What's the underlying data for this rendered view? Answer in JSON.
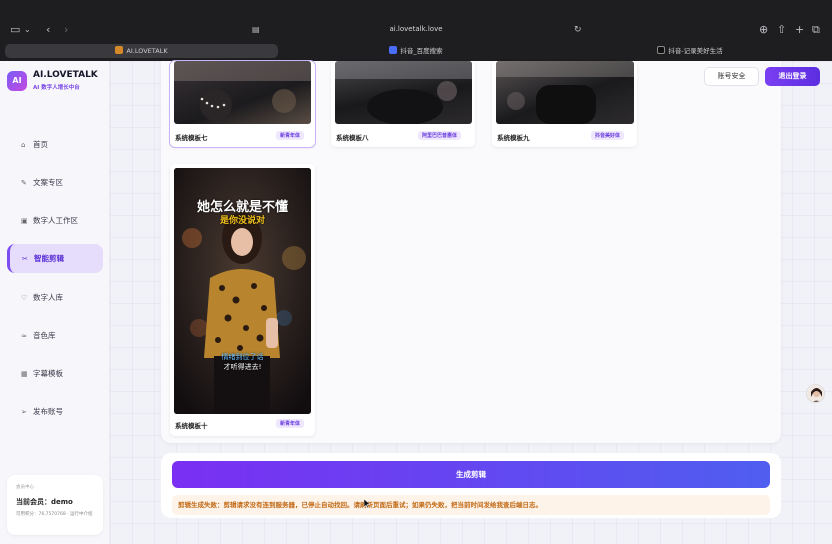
{
  "browser": {
    "url": "ai.lovetalk.love",
    "tabs": [
      {
        "label": "AI.LOVETALK",
        "active": true
      },
      {
        "label": "抖音_百度搜索",
        "active": false
      },
      {
        "label": "抖音-记录美好生活",
        "active": false
      }
    ]
  },
  "sidebar": {
    "logo": "AI",
    "brand": "AI.LOVETALK",
    "brand_sub": "AI 数字人增长中台",
    "items": [
      {
        "label": "首页",
        "icon": "home-icon",
        "glyph": "⌂"
      },
      {
        "label": "文案专区",
        "icon": "pen-icon",
        "glyph": "✎"
      },
      {
        "label": "数字人工作区",
        "icon": "workspace-icon",
        "glyph": "▣"
      },
      {
        "label": "智能剪辑",
        "icon": "scissors-icon",
        "glyph": "✂",
        "active": true
      },
      {
        "label": "数字人库",
        "icon": "heart-icon",
        "glyph": "♡"
      },
      {
        "label": "音色库",
        "icon": "sound-icon",
        "glyph": "≈"
      },
      {
        "label": "字幕模板",
        "icon": "grid-icon",
        "glyph": "▦"
      },
      {
        "label": "发布账号",
        "icon": "send-icon",
        "glyph": "➢"
      }
    ],
    "member": {
      "label": "会员中心",
      "name": "当前会员：demo",
      "points": "可用积分：76,7570768 · 运行中介绍"
    }
  },
  "header": {
    "security_button": "账号安全",
    "logout_button": "退出登录"
  },
  "templates": [
    {
      "title": "系统模板七",
      "tag": "新青年体",
      "selected": true
    },
    {
      "title": "系统模板八",
      "tag": "阿里巴巴普惠体"
    },
    {
      "title": "系统模板九",
      "tag": "抖音美好体"
    },
    {
      "title": "系统模板十",
      "tag": "新青年体",
      "overlay_title": "她怎么就是不懂",
      "overlay_sub": "是你没说对",
      "caption_line1": "情绪到位了话",
      "caption_line2": "才听得进去!"
    }
  ],
  "actions": {
    "generate_button": "生成剪辑",
    "error_message": "剪辑生成失败：剪辑请求没有连到服务器，已停止自动找回。请刷新页面后重试；如果仍失败，把当前时间发给我查后端日志。"
  },
  "colors": {
    "accent": "#7b3ff2",
    "active_nav_bg": "#e6dcfb",
    "error_text": "#c26a16",
    "error_bg": "#fdf3e8"
  }
}
